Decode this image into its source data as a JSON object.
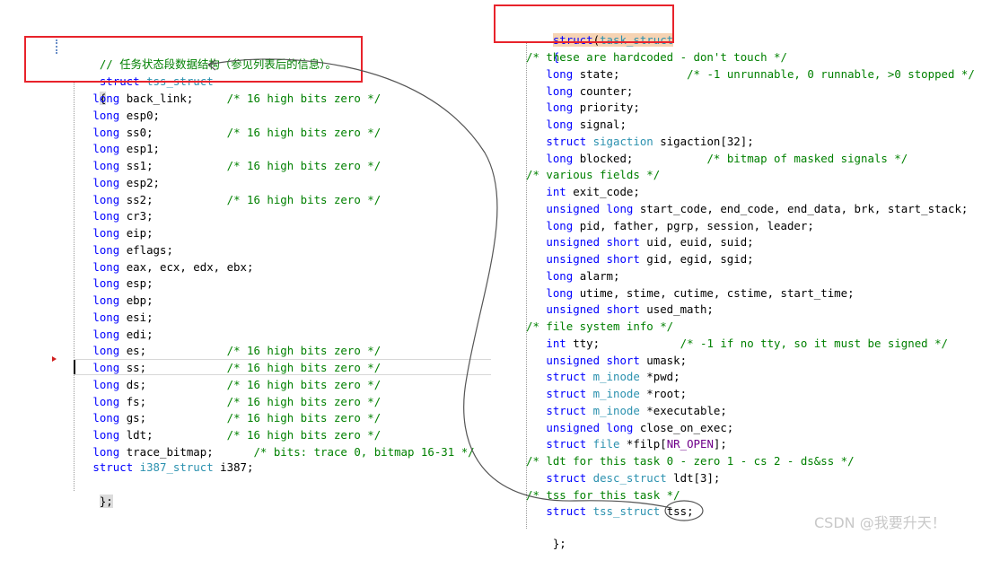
{
  "left": {
    "comment": "// 任务状态段数据结构（参见列表后的信息）。",
    "struct_kw": "struct",
    "struct_name": "tss_struct",
    "open_brace": "{",
    "close_brace": "};",
    "fields": [
      {
        "type": "long",
        "name": " back_link;",
        "pad": "     ",
        "comment": "/* 16 high bits zero */"
      },
      {
        "type": "long",
        "name": " esp0;",
        "pad": "",
        "comment": ""
      },
      {
        "type": "long",
        "name": " ss0;",
        "pad": "           ",
        "comment": "/* 16 high bits zero */"
      },
      {
        "type": "long",
        "name": " esp1;",
        "pad": "",
        "comment": ""
      },
      {
        "type": "long",
        "name": " ss1;",
        "pad": "           ",
        "comment": "/* 16 high bits zero */"
      },
      {
        "type": "long",
        "name": " esp2;",
        "pad": "",
        "comment": ""
      },
      {
        "type": "long",
        "name": " ss2;",
        "pad": "           ",
        "comment": "/* 16 high bits zero */"
      },
      {
        "type": "long",
        "name": " cr3;",
        "pad": "",
        "comment": ""
      },
      {
        "type": "long",
        "name": " eip;",
        "pad": "",
        "comment": ""
      },
      {
        "type": "long",
        "name": " eflags;",
        "pad": "",
        "comment": ""
      },
      {
        "type": "long",
        "name": " eax, ecx, edx, ebx;",
        "pad": "",
        "comment": ""
      },
      {
        "type": "long",
        "name": " esp;",
        "pad": "",
        "comment": ""
      },
      {
        "type": "long",
        "name": " ebp;",
        "pad": "",
        "comment": ""
      },
      {
        "type": "long",
        "name": " esi;",
        "pad": "",
        "comment": ""
      },
      {
        "type": "long",
        "name": " edi;",
        "pad": "",
        "comment": ""
      },
      {
        "type": "long",
        "name": " es;",
        "pad": "            ",
        "comment": "/* 16 high bits zero */"
      },
      {
        "type": "long",
        "name": " ss;",
        "pad": "            ",
        "comment": "/* 16 high bits zero */"
      },
      {
        "type": "long",
        "name": " ds;",
        "pad": "            ",
        "comment": "/* 16 high bits zero */"
      },
      {
        "type": "long",
        "name": " fs;",
        "pad": "            ",
        "comment": "/* 16 high bits zero */"
      },
      {
        "type": "long",
        "name": " gs;",
        "pad": "            ",
        "comment": "/* 16 high bits zero */"
      },
      {
        "type": "long",
        "name": " ldt;",
        "pad": "           ",
        "comment": "/* 16 high bits zero */"
      },
      {
        "type": "long",
        "name": " trace_bitmap;",
        "pad": "      ",
        "comment": "/* bits: trace 0, bitmap 16-31 */"
      }
    ],
    "last_field": {
      "kw": "struct",
      "type": "i387_struct",
      "name": " i387;"
    }
  },
  "right": {
    "header_kw": "struct",
    "header_paren": "(",
    "header_name": "task_struct",
    "open_brace": "{",
    "close_brace": "};",
    "lines": [
      [
        {
          "t": "/* these are hardcoded - don't touch */",
          "c": "cm"
        }
      ],
      [
        {
          "t": "   "
        },
        {
          "t": "long",
          "c": "kw"
        },
        {
          "t": " state;          "
        },
        {
          "t": "/* -1 unrunnable, 0 runnable, >0 stopped */",
          "c": "cm"
        }
      ],
      [
        {
          "t": "   "
        },
        {
          "t": "long",
          "c": "kw"
        },
        {
          "t": " counter;"
        }
      ],
      [
        {
          "t": "   "
        },
        {
          "t": "long",
          "c": "kw"
        },
        {
          "t": " priority;"
        }
      ],
      [
        {
          "t": "   "
        },
        {
          "t": "long",
          "c": "kw"
        },
        {
          "t": " signal;"
        }
      ],
      [
        {
          "t": "   "
        },
        {
          "t": "struct",
          "c": "kw"
        },
        {
          "t": " "
        },
        {
          "t": "sigaction",
          "c": "ty"
        },
        {
          "t": " sigaction[32];"
        }
      ],
      [
        {
          "t": "   "
        },
        {
          "t": "long",
          "c": "kw"
        },
        {
          "t": " blocked;           "
        },
        {
          "t": "/* bitmap of masked signals */",
          "c": "cm"
        }
      ],
      [
        {
          "t": "/* various fields */",
          "c": "cm"
        }
      ],
      [
        {
          "t": "   "
        },
        {
          "t": "int",
          "c": "kw"
        },
        {
          "t": " exit_code;"
        }
      ],
      [
        {
          "t": "   "
        },
        {
          "t": "unsigned long",
          "c": "kw"
        },
        {
          "t": " start_code, end_code, end_data, brk, start_stack;"
        }
      ],
      [
        {
          "t": "   "
        },
        {
          "t": "long",
          "c": "kw"
        },
        {
          "t": " pid, father, pgrp, session, leader;"
        }
      ],
      [
        {
          "t": "   "
        },
        {
          "t": "unsigned short",
          "c": "kw"
        },
        {
          "t": " uid, euid, suid;"
        }
      ],
      [
        {
          "t": "   "
        },
        {
          "t": "unsigned short",
          "c": "kw"
        },
        {
          "t": " gid, egid, sgid;"
        }
      ],
      [
        {
          "t": "   "
        },
        {
          "t": "long",
          "c": "kw"
        },
        {
          "t": " alarm;"
        }
      ],
      [
        {
          "t": "   "
        },
        {
          "t": "long",
          "c": "kw"
        },
        {
          "t": " utime, stime, cutime, cstime, start_time;"
        }
      ],
      [
        {
          "t": "   "
        },
        {
          "t": "unsigned short",
          "c": "kw"
        },
        {
          "t": " used_math;"
        }
      ],
      [
        {
          "t": "/* file system info */",
          "c": "cm"
        }
      ],
      [
        {
          "t": "   "
        },
        {
          "t": "int",
          "c": "kw"
        },
        {
          "t": " tty;            "
        },
        {
          "t": "/* -1 if no tty, so it must be signed */",
          "c": "cm"
        }
      ],
      [
        {
          "t": "   "
        },
        {
          "t": "unsigned short",
          "c": "kw"
        },
        {
          "t": " umask;"
        }
      ],
      [
        {
          "t": "   "
        },
        {
          "t": "struct",
          "c": "kw"
        },
        {
          "t": " "
        },
        {
          "t": "m_inode",
          "c": "ty"
        },
        {
          "t": " *pwd;"
        }
      ],
      [
        {
          "t": "   "
        },
        {
          "t": "struct",
          "c": "kw"
        },
        {
          "t": " "
        },
        {
          "t": "m_inode",
          "c": "ty"
        },
        {
          "t": " *root;"
        }
      ],
      [
        {
          "t": "   "
        },
        {
          "t": "struct",
          "c": "kw"
        },
        {
          "t": " "
        },
        {
          "t": "m_inode",
          "c": "ty"
        },
        {
          "t": " *executable;"
        }
      ],
      [
        {
          "t": "   "
        },
        {
          "t": "unsigned long",
          "c": "kw"
        },
        {
          "t": " close_on_exec;"
        }
      ],
      [
        {
          "t": "   "
        },
        {
          "t": "struct",
          "c": "kw"
        },
        {
          "t": " "
        },
        {
          "t": "file",
          "c": "ty"
        },
        {
          "t": " *filp["
        },
        {
          "t": "NR_OPEN",
          "c": "mac"
        },
        {
          "t": "];"
        }
      ],
      [
        {
          "t": "/* ldt for this task 0 - zero 1 - cs 2 - ds&ss */",
          "c": "cm"
        }
      ],
      [
        {
          "t": "   "
        },
        {
          "t": "struct",
          "c": "kw"
        },
        {
          "t": " "
        },
        {
          "t": "desc_struct",
          "c": "ty"
        },
        {
          "t": " ldt[3];"
        }
      ],
      [
        {
          "t": "/* tss for this task */",
          "c": "cm"
        }
      ],
      [
        {
          "t": "   "
        },
        {
          "t": "struct",
          "c": "kw"
        },
        {
          "t": " "
        },
        {
          "t": "tss_struct",
          "c": "ty"
        },
        {
          "t": " tss;"
        }
      ]
    ]
  },
  "watermark": "CSDN @我要升天！",
  "colors": {
    "keyword": "#0000ff",
    "type": "#2b91af",
    "comment": "#008000",
    "macro": "#6f008a",
    "annotation_red": "#e8232b",
    "highlight": "#f6d3b3"
  }
}
